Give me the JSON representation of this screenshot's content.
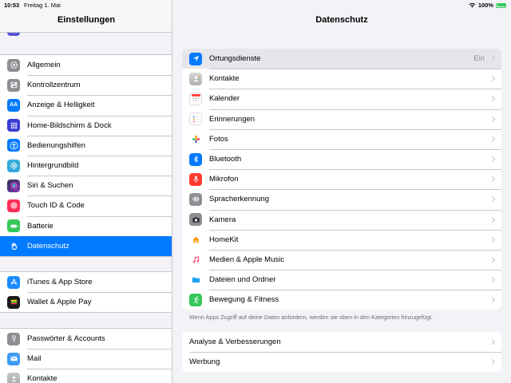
{
  "statusbar": {
    "time": "10:53",
    "date": "Freitag 1. Mai",
    "battery": "100%"
  },
  "sidebar": {
    "title": "Einstellungen",
    "groups": [
      [
        {
          "label": "Allgemein",
          "icon": "gear-icon",
          "color": "#8e8e93"
        },
        {
          "label": "Kontrollzentrum",
          "icon": "toggles-icon",
          "color": "#8e8e93"
        },
        {
          "label": "Anzeige & Helligkeit",
          "icon": "text-size-icon",
          "color": "#007aff"
        },
        {
          "label": "Home-Bildschirm & Dock",
          "icon": "grid-icon",
          "color": "#3b3bd6"
        },
        {
          "label": "Bedienungshilfen",
          "icon": "accessibility-icon",
          "color": "#007aff"
        },
        {
          "label": "Hintergrundbild",
          "icon": "flower-icon",
          "color": "#34aadc"
        },
        {
          "label": "Siri & Suchen",
          "icon": "siri-icon",
          "color": "#2c2c54"
        },
        {
          "label": "Touch ID & Code",
          "icon": "fingerprint-icon",
          "color": "#ff2d55"
        },
        {
          "label": "Batterie",
          "icon": "battery-icon",
          "color": "#34c759"
        },
        {
          "label": "Datenschutz",
          "icon": "hand-icon",
          "color": "#007aff"
        }
      ],
      [
        {
          "label": "iTunes & App Store",
          "icon": "app-store-icon",
          "color": "#1a8cff"
        },
        {
          "label": "Wallet & Apple Pay",
          "icon": "wallet-icon",
          "color": "#1c1c1e"
        }
      ],
      [
        {
          "label": "Passwörter & Accounts",
          "icon": "key-icon",
          "color": "#8e8e93"
        },
        {
          "label": "Mail",
          "icon": "mail-icon",
          "color": "#3d9bf5"
        },
        {
          "label": "Kontakte",
          "icon": "contacts-icon",
          "color": "#a8a8a8"
        }
      ]
    ],
    "selected": "Datenschutz"
  },
  "main": {
    "title": "Datenschutz",
    "items": [
      {
        "label": "Ortungsdienste",
        "detail": "Ein",
        "icon": "location-arrow-icon",
        "color": "#007aff"
      },
      {
        "label": "Kontakte",
        "icon": "contacts-icon",
        "color": "#b0b0b0"
      },
      {
        "label": "Kalender",
        "icon": "calendar-icon",
        "color": "#ffffff"
      },
      {
        "label": "Erinnerungen",
        "icon": "reminders-icon",
        "color": "#ffffff"
      },
      {
        "label": "Fotos",
        "icon": "photos-icon",
        "color": "#ffffff"
      },
      {
        "label": "Bluetooth",
        "icon": "bluetooth-icon",
        "color": "#007aff"
      },
      {
        "label": "Mikrofon",
        "icon": "microphone-icon",
        "color": "#ff3b30"
      },
      {
        "label": "Spracherkennung",
        "icon": "waveform-icon",
        "color": "#8e8e93"
      },
      {
        "label": "Kamera",
        "icon": "camera-icon",
        "color": "#8e8e93"
      },
      {
        "label": "HomeKit",
        "icon": "house-icon",
        "color": "#ffffff"
      },
      {
        "label": "Medien & Apple Music",
        "icon": "music-note-icon",
        "color": "#ffffff"
      },
      {
        "label": "Dateien und Ordner",
        "icon": "folder-icon",
        "color": "#ffffff"
      },
      {
        "label": "Bewegung & Fitness",
        "icon": "running-icon",
        "color": "#34c759"
      }
    ],
    "footnote": "Wenn Apps Zugriff auf deine Daten anfordern, werden sie oben in den Kategorien hinzugefügt.",
    "items2": [
      {
        "label": "Analyse & Verbesserungen"
      },
      {
        "label": "Werbung"
      }
    ]
  }
}
